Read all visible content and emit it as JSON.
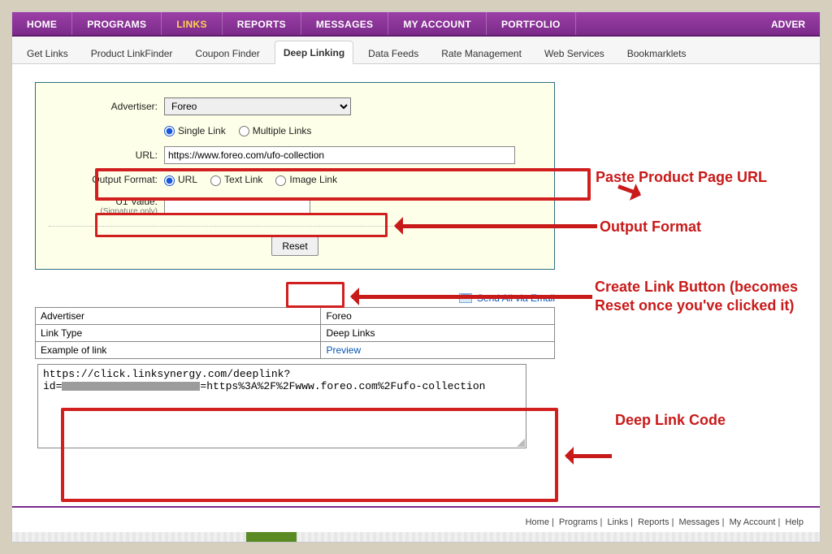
{
  "main_nav": {
    "items": [
      "HOME",
      "PROGRAMS",
      "LINKS",
      "REPORTS",
      "MESSAGES",
      "MY ACCOUNT",
      "PORTFOLIO"
    ],
    "active_index": 2,
    "right_label": "ADVER"
  },
  "sub_nav": {
    "tabs": [
      "Get Links",
      "Product LinkFinder",
      "Coupon Finder",
      "Deep Linking",
      "Data Feeds",
      "Rate Management",
      "Web Services",
      "Bookmarklets"
    ],
    "active_index": 3
  },
  "form": {
    "advertiser_label": "Advertiser:",
    "advertiser_value": "Foreo",
    "link_type": {
      "single": "Single Link",
      "multiple": "Multiple Links",
      "selected": "single"
    },
    "url_label": "URL:",
    "url_value": "https://www.foreo.com/ufo-collection",
    "output_label": "Output Format:",
    "outputs": {
      "url": "URL",
      "text": "Text Link",
      "image": "Image Link",
      "selected": "url"
    },
    "u1_label": "U1 Value:",
    "u1_sub": "(Signature only)",
    "u1_value": "",
    "reset_label": "Reset"
  },
  "callouts": {
    "c1": "Paste Product Page URL",
    "c2": "Output Format",
    "c3": "Create Link Button (becomes Reset once you've clicked it)",
    "c4": "Deep Link Code"
  },
  "email": {
    "label": "Send All via Email"
  },
  "results": {
    "rows": [
      {
        "k": "Advertiser",
        "v": "Foreo",
        "vlink": false
      },
      {
        "k": "Link Type",
        "v": "Deep Links",
        "vlink": false
      },
      {
        "k": "Example of link",
        "v": "Preview",
        "vlink": true
      }
    ]
  },
  "deeplink": {
    "prefix": "https://click.linksynergy.com/deeplink?\nid=",
    "suffix": "=https%3A%2F%2Fwww.foreo.com%2Fufo-collection"
  },
  "footer": {
    "links": [
      "Home",
      "Programs",
      "Links",
      "Reports",
      "Messages",
      "My Account",
      "Help"
    ]
  }
}
